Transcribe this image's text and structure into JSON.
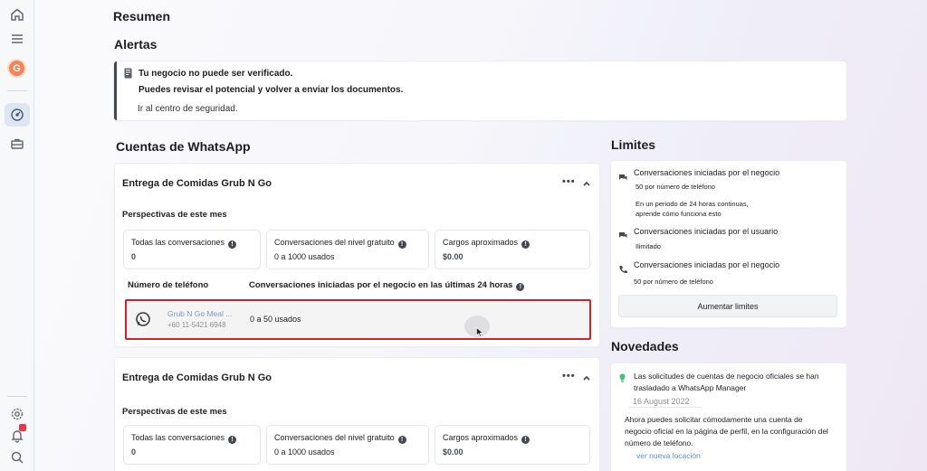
{
  "rail": {
    "avatar_letter": "G"
  },
  "headings": {
    "summary": "Resumen",
    "alerts": "Alertas",
    "whatsapp_accounts": "Cuentas de WhatsApp",
    "limits": "Limites",
    "news": "Novedades"
  },
  "alert": {
    "title": "Tu negocio no puede ser verificado.",
    "description": "Puedes revisar el potencial y volver a enviar los documentos.",
    "link": "Ir al centro de seguridad."
  },
  "accounts": [
    {
      "name": "Entrega de Comidas Grub N Go",
      "more": "•••",
      "perspectives": "Perspectivas de este mes",
      "metrics": [
        {
          "label": "Todas las conversaciones",
          "value": "0"
        },
        {
          "label": "Conversaciones del nivel gratuito",
          "value": "0 a 1000 usados"
        },
        {
          "label": "Cargos aproximados",
          "value": "$0.00"
        }
      ],
      "phone_header": "Número de teléfono",
      "usage_header": "Conversaciones iniciadas por el negocio en las últimas 24 horas",
      "phone": {
        "name": "Grub N Go Meal ...",
        "number": "+60 11-5421 6948",
        "usage": "0 a 50 usados"
      }
    },
    {
      "name": "Entrega de Comidas Grub N Go",
      "more": "•••",
      "perspectives": "Perspectivas de este mes",
      "metrics": [
        {
          "label": "Todas las conversaciones",
          "value": "0"
        },
        {
          "label": "Conversaciones del nivel gratuito",
          "value": "0 a 1000 usados"
        },
        {
          "label": "Cargos aproximados",
          "value": "$0.00"
        }
      ]
    }
  ],
  "limits": {
    "items": [
      {
        "title": "Conversaciones iniciadas por el negocio",
        "sub": "50 por número de teléfono",
        "note1": "En un periodo de 24 horas continuas,",
        "note2": "aprende cómo funciona esto"
      },
      {
        "title": "Conversaciones iniciadas por el usuario",
        "sub": "Ilimitado"
      },
      {
        "title": "Conversaciones iniciadas por el negocio",
        "sub": "50 por número de teléfono"
      }
    ],
    "button": "Aumentar limites"
  },
  "news": {
    "headline1": "Las solicitudes de cuentas de negocio oficiales se han",
    "headline2": "trasladado a WhatsApp Manager",
    "date": "16 August 2022",
    "body1": "Ahora puedes solicitar cómodamente una cuenta de",
    "body2": "negocio oficial en la página de perfil, en la configuración del",
    "body3": "número de teléfono.",
    "link": "ver nueva locación"
  },
  "colors": {
    "accent_red": "#c8252c",
    "link_blue": "#5a8ed6",
    "avatar_orange": "#f0845a"
  }
}
